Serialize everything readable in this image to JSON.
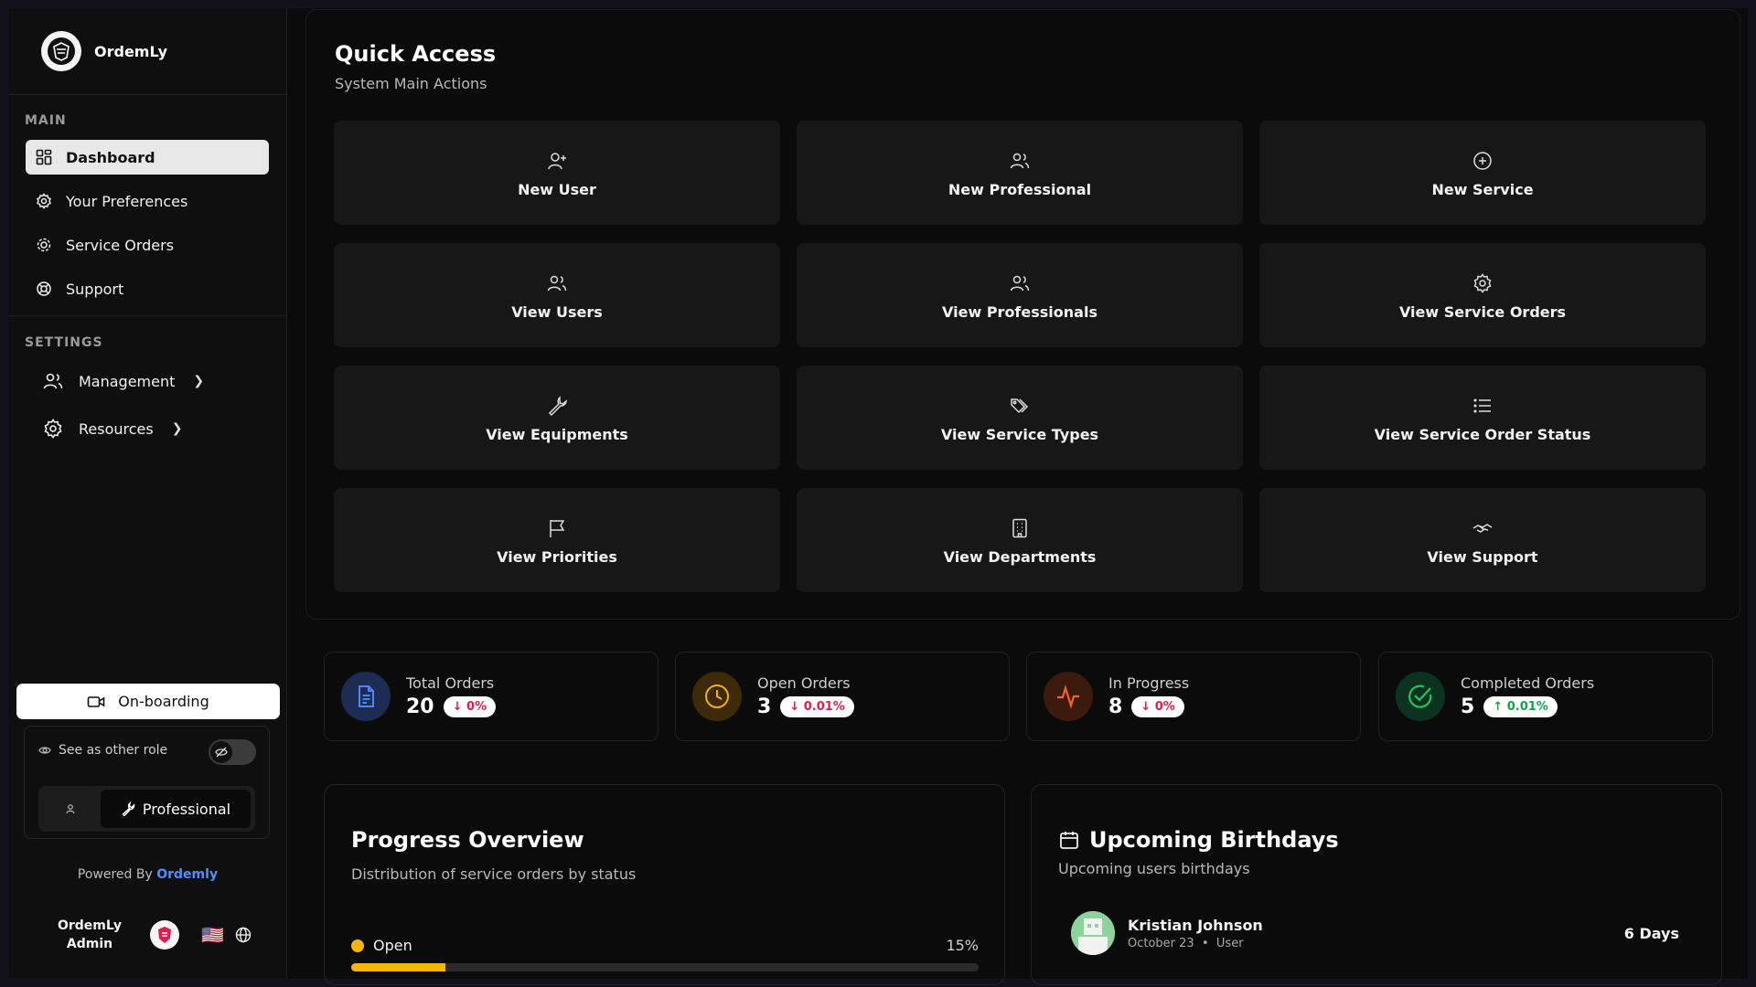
{
  "brand": {
    "name": "OrdemLy"
  },
  "sidebar": {
    "main_label": "MAIN",
    "items": [
      {
        "label": "Dashboard",
        "icon": "dashboard-icon"
      },
      {
        "label": "Your Preferences",
        "icon": "gear-icon"
      },
      {
        "label": "Service Orders",
        "icon": "cog-icon"
      },
      {
        "label": "Support",
        "icon": "lifebuoy-icon"
      }
    ],
    "settings_label": "SETTINGS",
    "groups": [
      {
        "label": "Management",
        "icon": "users-icon"
      },
      {
        "label": "Resources",
        "icon": "settings-icon"
      }
    ],
    "onboarding_label": "On-boarding",
    "see_as_role_label": "See as other role",
    "role_selected": "Professional",
    "powered_prefix": "Powered By",
    "powered_brand": "Ordemly",
    "user_name_line1": "OrdemLy",
    "user_name_line2": "Admin",
    "flag": "🇺🇸"
  },
  "quick_access": {
    "title": "Quick Access",
    "subtitle": "System Main Actions",
    "tiles": [
      {
        "label": "New User",
        "icon": "user-plus-icon"
      },
      {
        "label": "New Professional",
        "icon": "users-icon"
      },
      {
        "label": "New Service",
        "icon": "plus-circle-icon"
      },
      {
        "label": "View Users",
        "icon": "users-icon"
      },
      {
        "label": "View Professionals",
        "icon": "users-icon"
      },
      {
        "label": "View Service Orders",
        "icon": "cog-icon"
      },
      {
        "label": "View Equipments",
        "icon": "wrench-icon"
      },
      {
        "label": "View Service Types",
        "icon": "tags-icon"
      },
      {
        "label": "View Service Order Status",
        "icon": "list-icon"
      },
      {
        "label": "View Priorities",
        "icon": "flag-icon"
      },
      {
        "label": "View Departments",
        "icon": "building-icon"
      },
      {
        "label": "View Support",
        "icon": "handshake-icon"
      }
    ]
  },
  "stats": [
    {
      "label": "Total Orders",
      "value": "20",
      "change": "0%",
      "direction": "down",
      "color": "#3b6fe0"
    },
    {
      "label": "Open Orders",
      "value": "3",
      "change": "0.01%",
      "direction": "down",
      "color": "#e6a410"
    },
    {
      "label": "In Progress",
      "value": "8",
      "change": "0%",
      "direction": "down",
      "color": "#e8542c"
    },
    {
      "label": "Completed Orders",
      "value": "5",
      "change": "0.01%",
      "direction": "up",
      "color": "#1fbf5f"
    }
  ],
  "progress": {
    "title": "Progress Overview",
    "subtitle": "Distribution of service orders by status",
    "rows": [
      {
        "label": "Open",
        "percent_label": "15%",
        "percent": 15,
        "color": "#f5b50b"
      }
    ]
  },
  "birthdays": {
    "title": "Upcoming Birthdays",
    "subtitle": "Upcoming users birthdays",
    "people": [
      {
        "name": "Kristian Johnson",
        "date": "October 23",
        "sep": "•",
        "role": "User",
        "days": "6 Days"
      }
    ]
  }
}
